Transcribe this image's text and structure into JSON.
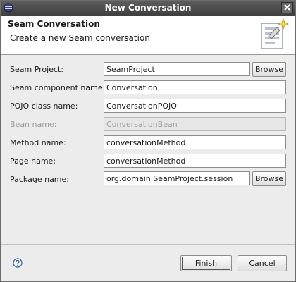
{
  "window": {
    "title": "New Conversation"
  },
  "header": {
    "title": "Seam Conversation",
    "description": "Create a new Seam conversation"
  },
  "form": {
    "seam_project": {
      "label": "Seam Project:",
      "value": "SeamProject",
      "browse_label": "Browse"
    },
    "component_name": {
      "label": "Seam component name:",
      "value": "Conversation"
    },
    "pojo_class": {
      "label": "POJO class name:",
      "value": "ConversationPOJO"
    },
    "bean_name": {
      "label": "Bean name:",
      "value": "ConversationBean",
      "enabled": false
    },
    "method_name": {
      "label": "Method name:",
      "value": "conversationMethod"
    },
    "page_name": {
      "label": "Page name:",
      "value": "conversationMethod"
    },
    "package_name": {
      "label": "Package name:",
      "value": "org.domain.SeamProject.session",
      "browse_label": "Browse"
    }
  },
  "buttons": {
    "finish": "Finish",
    "cancel": "Cancel"
  },
  "icons": {
    "app": "eclipse-icon",
    "close": "close-icon",
    "wizard": "wizard-banner-icon",
    "help": "help-icon"
  }
}
